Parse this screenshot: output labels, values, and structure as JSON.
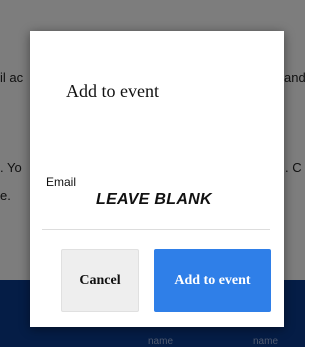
{
  "background": {
    "fragments": [
      "il ac",
      "and",
      ". Yo",
      ". C",
      "e.",
      "name",
      "name"
    ]
  },
  "modal": {
    "title": "Add to event",
    "email_label": "Email",
    "email_value": "LEAVE BLANK",
    "cancel_label": "Cancel",
    "add_label": "Add to event"
  },
  "colors": {
    "primary_button": "#2f7fe8",
    "footer": "#0b3a8c"
  }
}
